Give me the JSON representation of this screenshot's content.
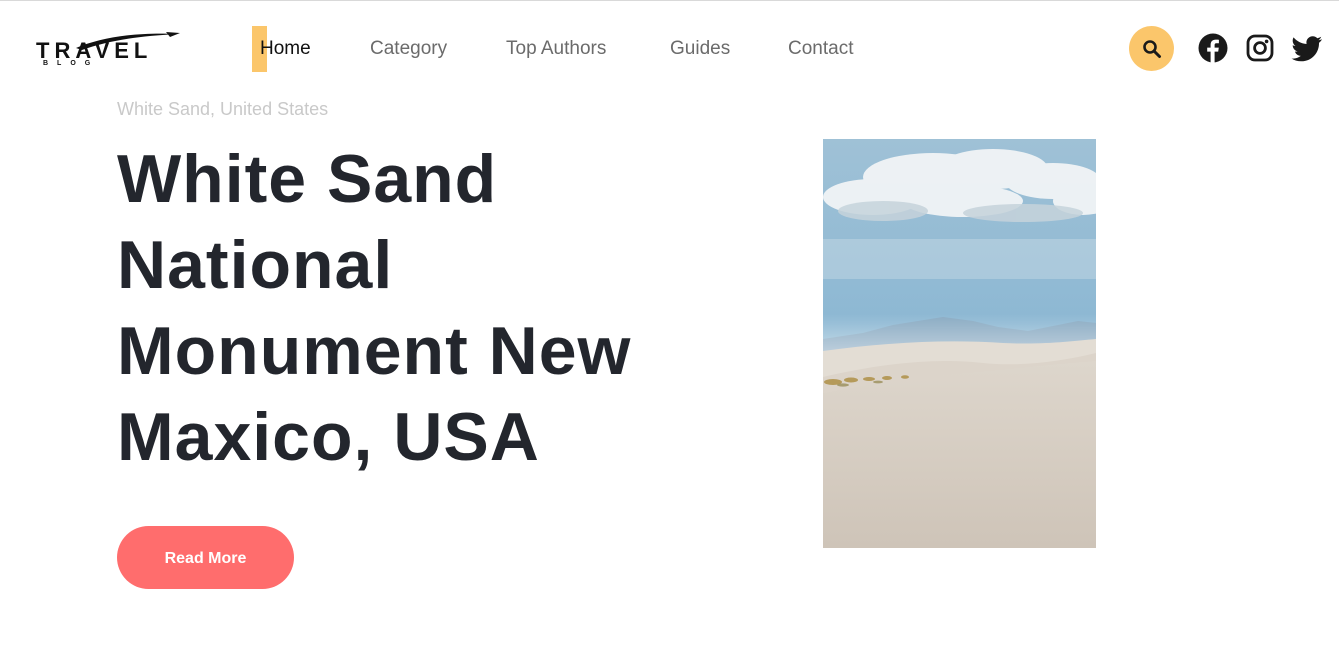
{
  "brand": {
    "name": "TRAVEL",
    "tagline": "BLOG"
  },
  "nav": {
    "items": [
      {
        "label": "Home",
        "active": true
      },
      {
        "label": "Category",
        "active": false
      },
      {
        "label": "Top Authors",
        "active": false
      },
      {
        "label": "Guides",
        "active": false
      },
      {
        "label": "Contact",
        "active": false
      }
    ]
  },
  "header_actions": {
    "search_icon": "search-icon",
    "social_icons": [
      "facebook-icon",
      "instagram-icon",
      "twitter-icon"
    ]
  },
  "hero": {
    "location": "White Sand, United States",
    "title": "White Sand National Monument New Maxico, USA",
    "cta_label": "Read More",
    "image_subject": "white sand dunes under a cloudy blue sky"
  },
  "colors": {
    "accent_yellow": "#fbc66b",
    "cta_coral": "#ff6d6d",
    "heading_dark": "#23262d",
    "nav_gray": "#6b6b6b",
    "muted_text": "#c9c9c9"
  }
}
